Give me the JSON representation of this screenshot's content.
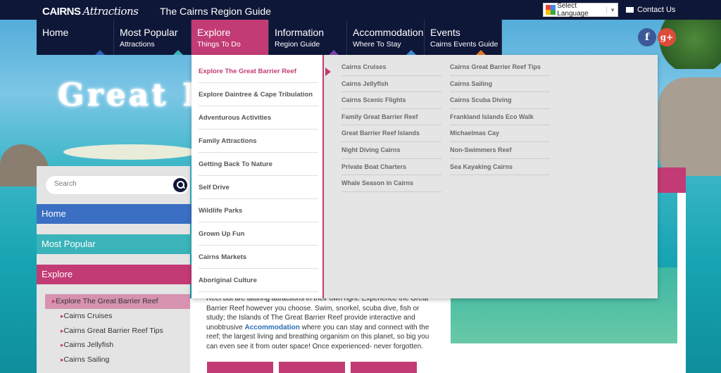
{
  "topbar": {
    "logo_bold": "CAIRNS",
    "logo_script": "Attractions",
    "tagline": "The Cairns Region Guide",
    "language_label": "Select Language",
    "contact_label": "Contact Us"
  },
  "nav": [
    {
      "main": "Home",
      "sub": "",
      "tri_color": "#2f5fb8"
    },
    {
      "main": "Most Popular",
      "sub": "Attractions",
      "tri_color": "#3ab3b9"
    },
    {
      "main": "Explore",
      "sub": "Things To Do",
      "tri_color": "#c23b74"
    },
    {
      "main": "Information",
      "sub": "Region Guide",
      "tri_color": "#7b3fb0"
    },
    {
      "main": "Accommodation",
      "sub": "Where To Stay",
      "tri_color": "#3a8fd8"
    },
    {
      "main": "Events",
      "sub": "Cairns Events Guide",
      "tri_color": "#e07a2a"
    }
  ],
  "banner_title": "Great B",
  "mega": {
    "left": [
      "Explore The Great Barrier Reef",
      "Explore Daintree & Cape Tribulation",
      "Adventurous Activities",
      "Family Attractions",
      "Getting Back To Nature",
      "Self Drive",
      "Wildlife Parks",
      "Grown Up Fun",
      "Cairns Markets",
      "Aboriginal Culture"
    ],
    "col1": [
      "Cairns Cruises",
      "Cairns Jellyfish",
      "Cairns Scenic Flights",
      "Family Great Barrier Reef",
      "Great Barrier Reef Islands",
      "Night Diving Cairns",
      "Private Boat Charters",
      "Whale Season in Cairns"
    ],
    "col2": [
      "Cairns Great Barrier Reef Tips",
      "Cairns Sailing",
      "Cairns Scuba Diving",
      "Frankland Islands Eco Walk",
      "Michaelmas Cay",
      "Non-Swimmers Reef",
      "Sea Kayaking Cairns"
    ]
  },
  "sidebar": {
    "search_placeholder": "Search",
    "home": "Home",
    "most_popular": "Most Popular",
    "explore": "Explore",
    "sub_first": "Explore The Great Barrier Reef",
    "sub_items": [
      "Cairns Cruises",
      "Cairns Great Barrier Reef Tips",
      "Cairns Jellyfish",
      "Cairns Sailing"
    ]
  },
  "content": {
    "p1": "Reef but are alluring attractions in their own right. Experience the Great Barrier Reef however you choose. Swim, snorkel, scuba dive, fish or study; the Islands of The Great Barrier Reef provide interactive and unobtrusive ",
    "link": "Accommodation",
    "p2": " where you can stay and connect with the reef; the largest living and breathing organism on this planet, so big you can even see it from outer space! Once experienced- never forgotten."
  },
  "colors": {
    "navy": "#0f1738",
    "pink": "#c23b74",
    "home_blue": "#3a6fc3",
    "popular_teal": "#3ab3b9"
  }
}
